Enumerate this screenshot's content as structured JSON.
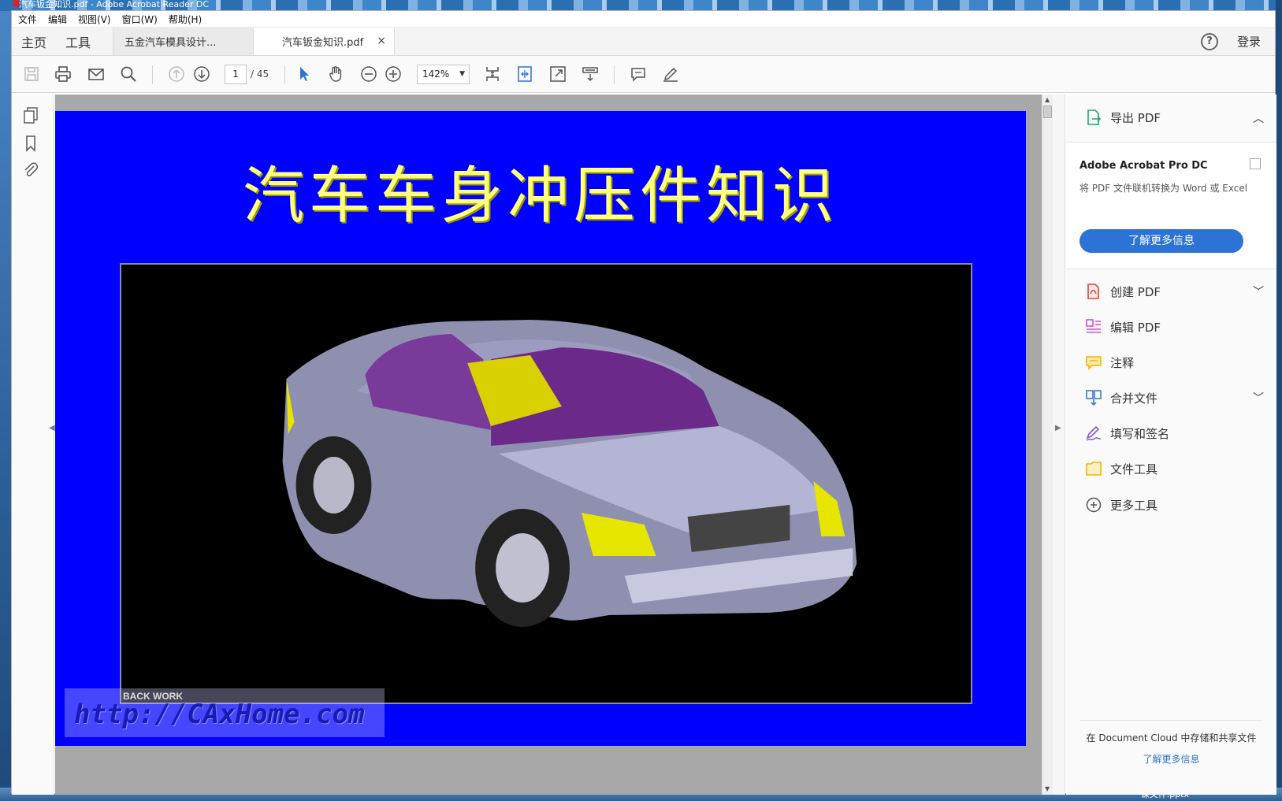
{
  "window": {
    "title": "汽车钣金知识.pdf - Adobe Acrobat Reader DC",
    "taskbar_text": "课文件.pptx"
  },
  "menu": [
    "文件",
    "编辑",
    "视图(V)",
    "窗口(W)",
    "帮助(H)"
  ],
  "tabs": {
    "home": "主页",
    "tools": "工具",
    "doc1": "五金汽车模具设计...",
    "doc2": "汽车钣金知识.pdf",
    "close_symbol": "×",
    "help_symbol": "?",
    "login": "登录"
  },
  "toolbar": {
    "page_current": "1",
    "page_total": "/ 45",
    "zoom": "142%",
    "icons": [
      "save-icon",
      "print-icon",
      "email-icon",
      "search-icon",
      "prev-page-icon",
      "next-page-icon",
      "select-icon",
      "hand-icon",
      "zoom-out-icon",
      "zoom-in-icon",
      "fit-page-icon",
      "fit-width-icon",
      "fullscreen-icon",
      "scroll-mode-icon",
      "comment-icon",
      "sign-icon"
    ]
  },
  "document": {
    "slide_title": "汽车车身冲压件知识",
    "watermark_small": "BACK WORK",
    "watermark_url": "http://CAxHome.com",
    "background_color": "#0000ff",
    "title_color": "#ffff80"
  },
  "right_panel": {
    "export": "导出 PDF",
    "promo_title": "Adobe Acrobat Pro DC",
    "promo_desc": "将 PDF 文件联机转换为 Word 或 Excel",
    "promo_button": "了解更多信息",
    "items": [
      {
        "label": "创建 PDF",
        "icon": "create-pdf-icon",
        "color": "#e0443c"
      },
      {
        "label": "编辑 PDF",
        "icon": "edit-pdf-icon",
        "color": "#d64fd0"
      },
      {
        "label": "注释",
        "icon": "comment-icon",
        "color": "#f2b800"
      },
      {
        "label": "合并文件",
        "icon": "combine-icon",
        "color": "#2d73d6"
      },
      {
        "label": "填写和签名",
        "icon": "fill-sign-icon",
        "color": "#7d5be0"
      },
      {
        "label": "文件工具",
        "icon": "file-tools-icon",
        "color": "#f2b800"
      },
      {
        "label": "更多工具",
        "icon": "more-tools-icon",
        "color": "#555555"
      }
    ],
    "footer_text": "在 Document Cloud 中存储和共享文件",
    "footer_link": "了解更多信息"
  }
}
